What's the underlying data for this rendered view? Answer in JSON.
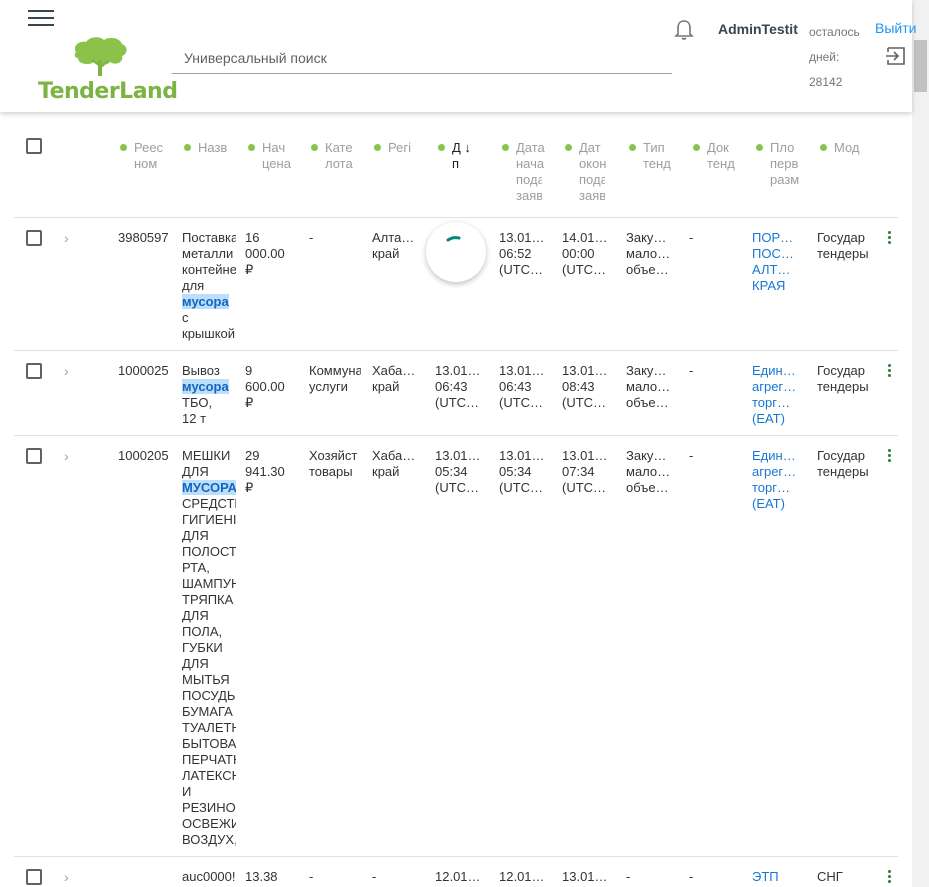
{
  "header": {
    "logo_text": "TenderLand",
    "search_placeholder": "Универсальный поиск",
    "user_name": "AdminTestit",
    "days_left_label_1": "осталось",
    "days_left_label_2": "дней:",
    "days_left_value": "28142",
    "logout_label": "Выйти"
  },
  "columns": [
    {
      "line1": "Реес",
      "line2": "ном",
      "line3": ""
    },
    {
      "line1": "Назв",
      "line2": "",
      "line3": ""
    },
    {
      "line1": "Нач",
      "line2": "цена",
      "line3": ""
    },
    {
      "line1": "Кате",
      "line2": "лота",
      "line3": ""
    },
    {
      "line1": "Регі",
      "line2": "",
      "line3": ""
    },
    {
      "line1": "Д ↓",
      "line2": "п",
      "line3": ""
    },
    {
      "line1": "Дата",
      "line2": "нача",
      "line3": "пода заяв"
    },
    {
      "line1": "Дат",
      "line2": "окон",
      "line3": "пода заяв"
    },
    {
      "line1": "Тип",
      "line2": "тенд",
      "line3": ""
    },
    {
      "line1": "Док",
      "line2": "тенд",
      "line3": ""
    },
    {
      "line1": "Пло",
      "line2": "перв",
      "line3": "разм"
    },
    {
      "line1": "Мод",
      "line2": "",
      "line3": ""
    }
  ],
  "rows": [
    {
      "reg": "3980597",
      "name_pre": "Поставка\nметалли\nконтейне\nдля\n",
      "name_hl": "мусора",
      "name_post": "\nс\nкрышкой",
      "price": "16\n000.00\n₽",
      "category": "-",
      "region": "Алта…\nкрай",
      "date_pub": "",
      "date_start": "13.01…\n06:52\n(UTC…",
      "date_end": "14.01…\n00:00\n(UTC…",
      "type": "Заку…\nмало…\nобъе…",
      "docs": "-",
      "platform": "ПОР…\nПОС…\nАЛТ…\nКРАЯ",
      "model": "Государ\nтендеры"
    },
    {
      "reg": "1000025",
      "name_pre": "Вывоз\n",
      "name_hl": "мусора",
      "name_post": "\nТБО,\n12 т",
      "price": "9\n600.00\n₽",
      "category": "Коммуна\nуслуги",
      "region": "Хаба…\nкрай",
      "date_pub": "13.01…\n06:43\n(UTC…",
      "date_start": "13.01…\n06:43\n(UTC…",
      "date_end": "13.01…\n08:43\n(UTC…",
      "type": "Заку…\nмало…\nобъе…",
      "docs": "-",
      "platform": "Един…\nагрег…\nторг…\n(ЕАТ)",
      "model": "Государ\nтендеры"
    },
    {
      "reg": "1000205",
      "name_pre": "МЕШКИ\nДЛЯ\n",
      "name_hl": "МУСОРА",
      "name_post": "\nСРЕДСТВ\nГИГИЕНІ\nДЛЯ\nПОЛОСТ\nРТА,\nШАМПУН\nТРЯПКА\nДЛЯ\nПОЛА,\nГУБКИ\nДЛЯ\nМЫТЬЯ\nПОСУДЫ\nБУМАГА\nТУАЛЕТН\nБЫТОВА\nПЕРЧАТН\nЛАТЕКСН\nИ\nРЕЗИНОІ\nОСВЕЖИ\nВОЗДУХ,",
      "price": "29\n941.30\n₽",
      "category": "Хозяйст\nтовары",
      "region": "Хаба…\nкрай",
      "date_pub": "13.01…\n05:34\n(UTC…",
      "date_start": "13.01…\n05:34\n(UTC…",
      "date_end": "13.01…\n07:34\n(UTC…",
      "type": "Заку…\nмало…\nобъе…",
      "docs": "-",
      "platform": "Един…\nагрег…\nторг…\n(ЕАТ)",
      "model": "Государ\nтендеры"
    },
    {
      "reg": "",
      "name_pre": "auc0000!",
      "name_hl": "",
      "name_post": "",
      "price": "13.38",
      "category": "-",
      "region": "-",
      "date_pub": "12.01…",
      "date_start": "12.01…",
      "date_end": "13.01…",
      "type": "-",
      "docs": "-",
      "platform": "ЭТП",
      "model": "СНГ"
    }
  ]
}
